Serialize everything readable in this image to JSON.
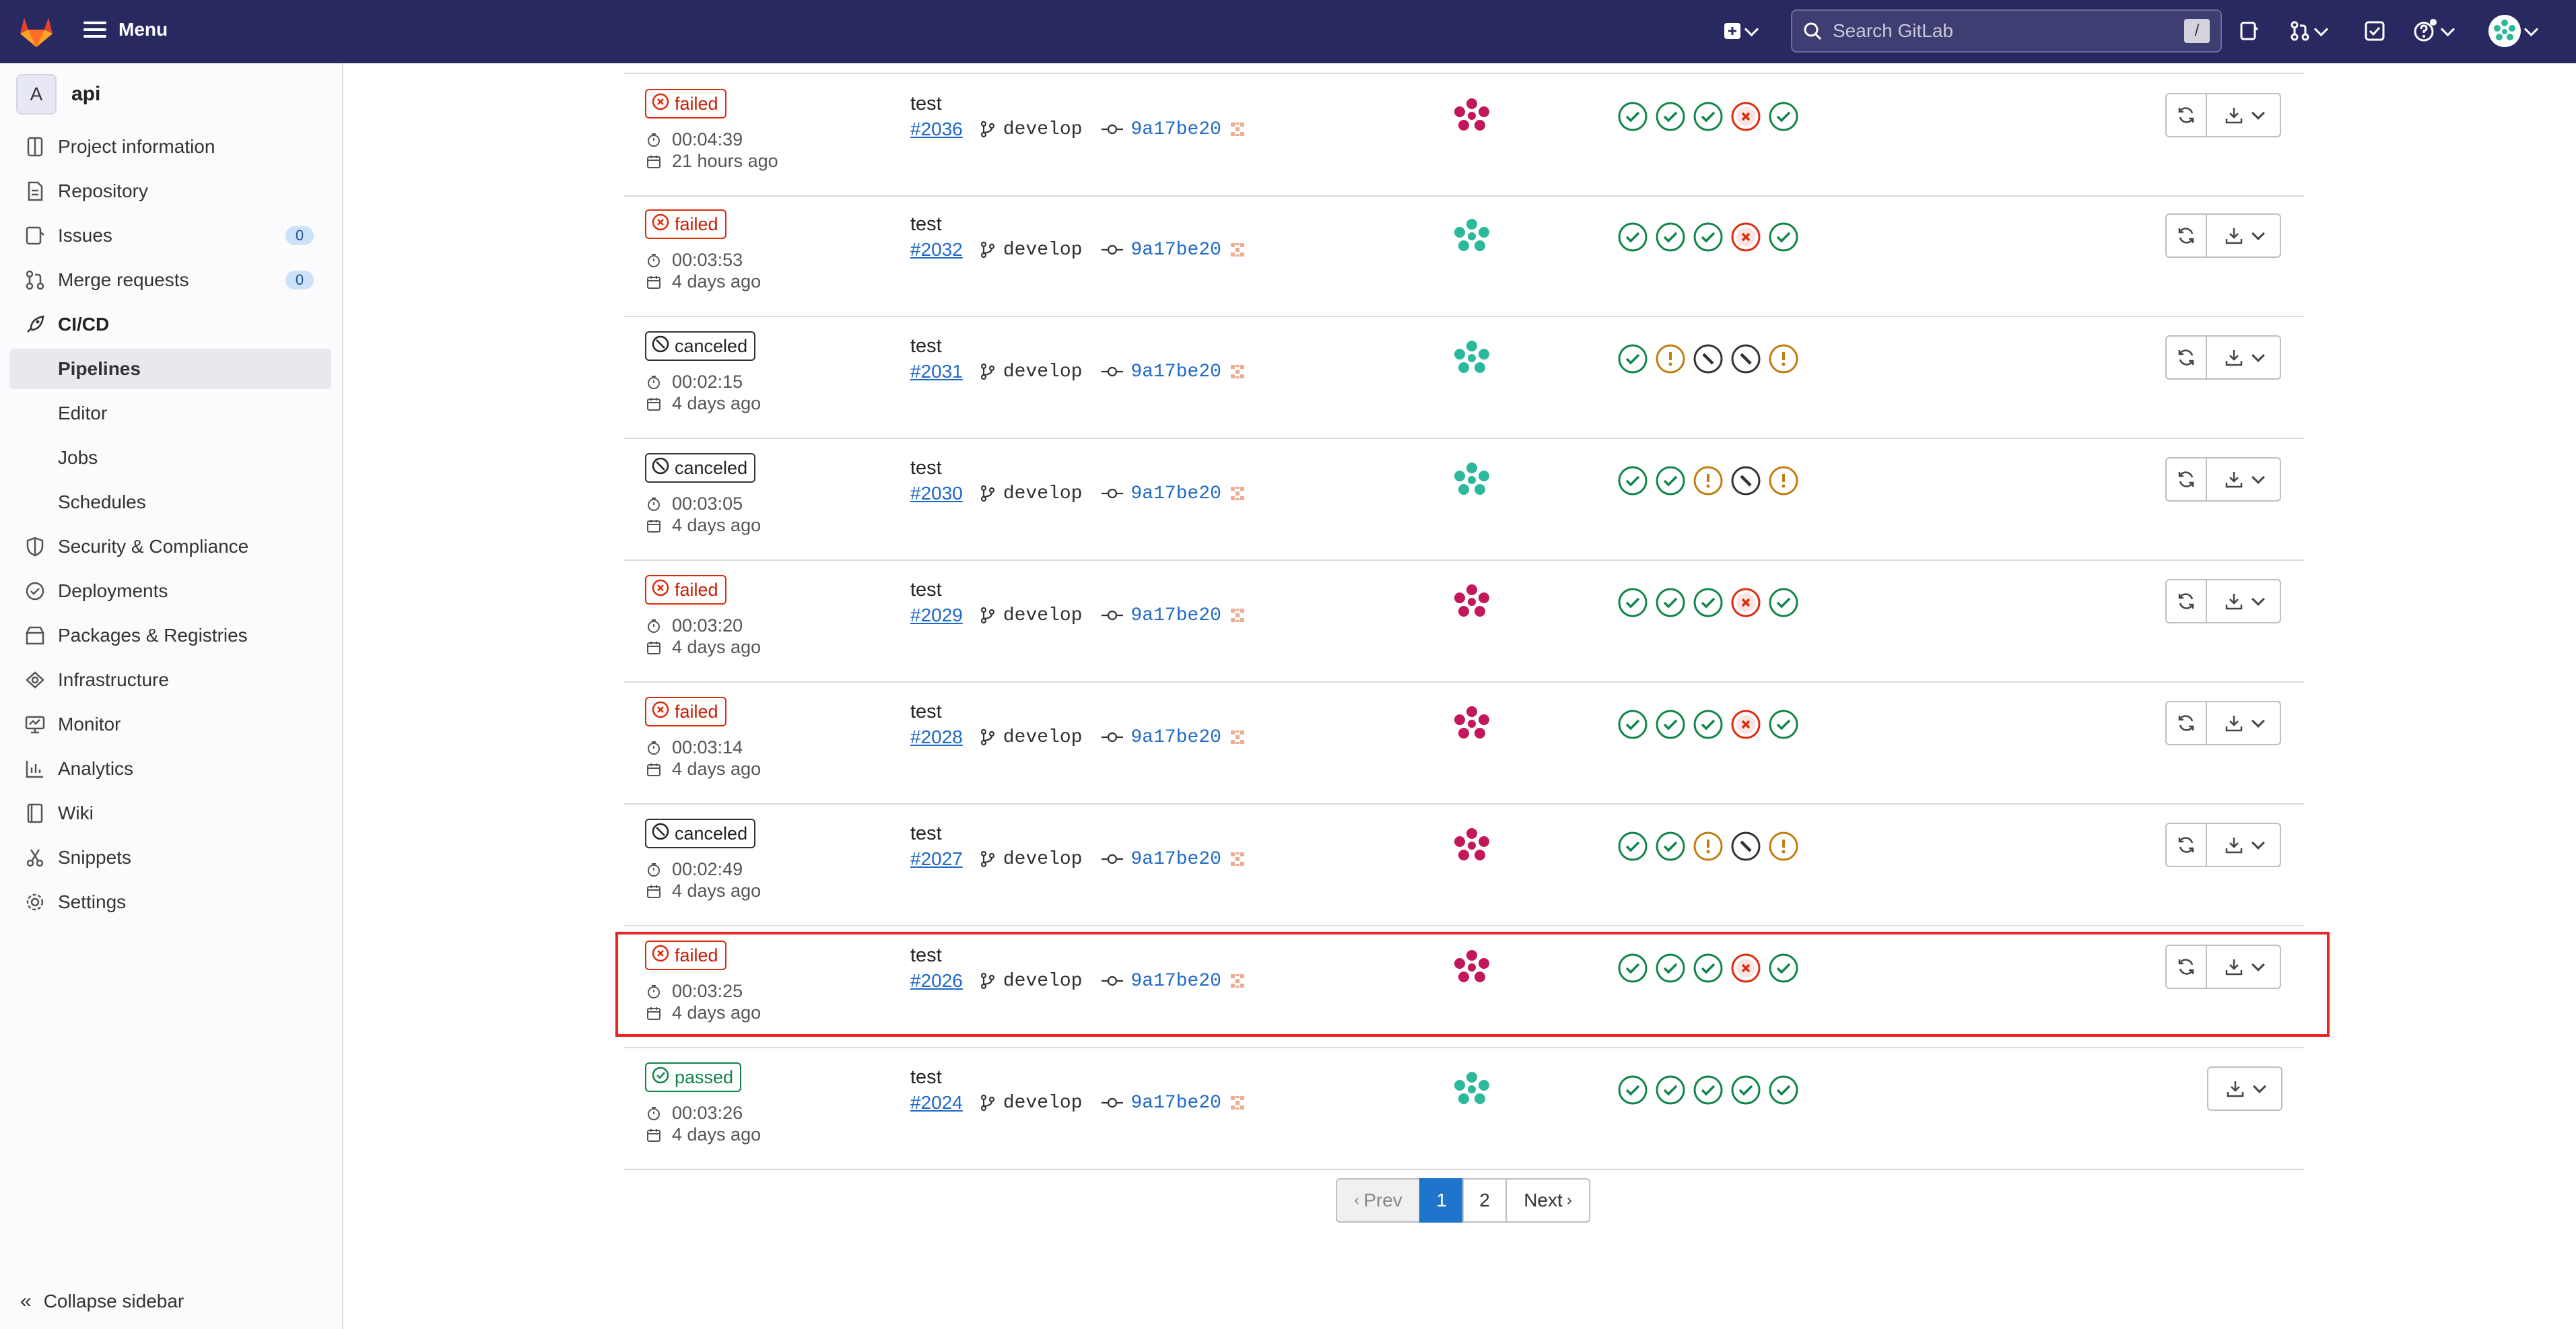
{
  "topbar": {
    "menu_label": "Menu",
    "search_placeholder": "Search GitLab",
    "search_shortcut": "/"
  },
  "project": {
    "avatar_letter": "A",
    "name": "api"
  },
  "sidebar": {
    "items": [
      {
        "label": "Project information",
        "icon": "info-icon"
      },
      {
        "label": "Repository",
        "icon": "doc-icon"
      },
      {
        "label": "Issues",
        "icon": "issues-icon",
        "count": "0"
      },
      {
        "label": "Merge requests",
        "icon": "merge-request-icon",
        "count": "0"
      },
      {
        "label": "CI/CD",
        "icon": "rocket-icon"
      },
      {
        "label": "Pipelines"
      },
      {
        "label": "Editor"
      },
      {
        "label": "Jobs"
      },
      {
        "label": "Schedules"
      },
      {
        "label": "Security & Compliance",
        "icon": "shield-icon"
      },
      {
        "label": "Deployments",
        "icon": "deployments-icon"
      },
      {
        "label": "Packages & Registries",
        "icon": "package-icon"
      },
      {
        "label": "Infrastructure",
        "icon": "cloud-icon"
      },
      {
        "label": "Monitor",
        "icon": "monitor-icon"
      },
      {
        "label": "Analytics",
        "icon": "chart-icon"
      },
      {
        "label": "Wiki",
        "icon": "book-icon"
      },
      {
        "label": "Snippets",
        "icon": "scissors-icon"
      },
      {
        "label": "Settings",
        "icon": "gear-icon"
      }
    ],
    "collapse_label": "Collapse sidebar"
  },
  "pipelines": [
    {
      "status": "failed",
      "duration": "00:04:39",
      "finished": "21 hours ago",
      "title": "test",
      "id": "#2036",
      "branch": "develop",
      "sha": "9a17be20",
      "avatar": "magenta",
      "stages": [
        "success",
        "success",
        "success",
        "failed",
        "success"
      ],
      "retry": true
    },
    {
      "status": "failed",
      "duration": "00:03:53",
      "finished": "4 days ago",
      "title": "test",
      "id": "#2032",
      "branch": "develop",
      "sha": "9a17be20",
      "avatar": "teal",
      "stages": [
        "success",
        "success",
        "success",
        "failed",
        "success"
      ],
      "retry": true
    },
    {
      "status": "canceled",
      "duration": "00:02:15",
      "finished": "4 days ago",
      "title": "test",
      "id": "#2031",
      "branch": "develop",
      "sha": "9a17be20",
      "avatar": "teal",
      "stages": [
        "success",
        "warning",
        "canceled",
        "canceled",
        "warning"
      ],
      "retry": true
    },
    {
      "status": "canceled",
      "duration": "00:03:05",
      "finished": "4 days ago",
      "title": "test",
      "id": "#2030",
      "branch": "develop",
      "sha": "9a17be20",
      "avatar": "teal",
      "stages": [
        "success",
        "success",
        "warning",
        "canceled",
        "warning"
      ],
      "retry": true
    },
    {
      "status": "failed",
      "duration": "00:03:20",
      "finished": "4 days ago",
      "title": "test",
      "id": "#2029",
      "branch": "develop",
      "sha": "9a17be20",
      "avatar": "magenta",
      "stages": [
        "success",
        "success",
        "success",
        "failed",
        "success"
      ],
      "retry": true
    },
    {
      "status": "failed",
      "duration": "00:03:14",
      "finished": "4 days ago",
      "title": "test",
      "id": "#2028",
      "branch": "develop",
      "sha": "9a17be20",
      "avatar": "magenta",
      "stages": [
        "success",
        "success",
        "success",
        "failed",
        "success"
      ],
      "retry": true
    },
    {
      "status": "canceled",
      "duration": "00:02:49",
      "finished": "4 days ago",
      "title": "test",
      "id": "#2027",
      "branch": "develop",
      "sha": "9a17be20",
      "avatar": "magenta",
      "stages": [
        "success",
        "success",
        "warning",
        "canceled",
        "warning"
      ],
      "retry": true
    },
    {
      "status": "failed",
      "duration": "00:03:25",
      "finished": "4 days ago",
      "title": "test",
      "id": "#2026",
      "branch": "develop",
      "sha": "9a17be20",
      "avatar": "magenta",
      "stages": [
        "success",
        "success",
        "success",
        "failed",
        "success"
      ],
      "retry": true
    },
    {
      "status": "passed",
      "duration": "00:03:26",
      "finished": "4 days ago",
      "title": "test",
      "id": "#2024",
      "branch": "develop",
      "sha": "9a17be20",
      "avatar": "teal",
      "stages": [
        "success",
        "success",
        "success",
        "success",
        "success"
      ],
      "retry": false
    }
  ],
  "pagination": {
    "prev": "Prev",
    "pages": [
      "1",
      "2"
    ],
    "current": "1",
    "next": "Next"
  },
  "colors": {
    "topbar": "#292961",
    "failed": "#dd2b0e",
    "passed": "#108548",
    "warning": "#c17d10",
    "link": "#1f69c6",
    "active_page": "#1f75cb",
    "highlight": "#ee2222"
  }
}
